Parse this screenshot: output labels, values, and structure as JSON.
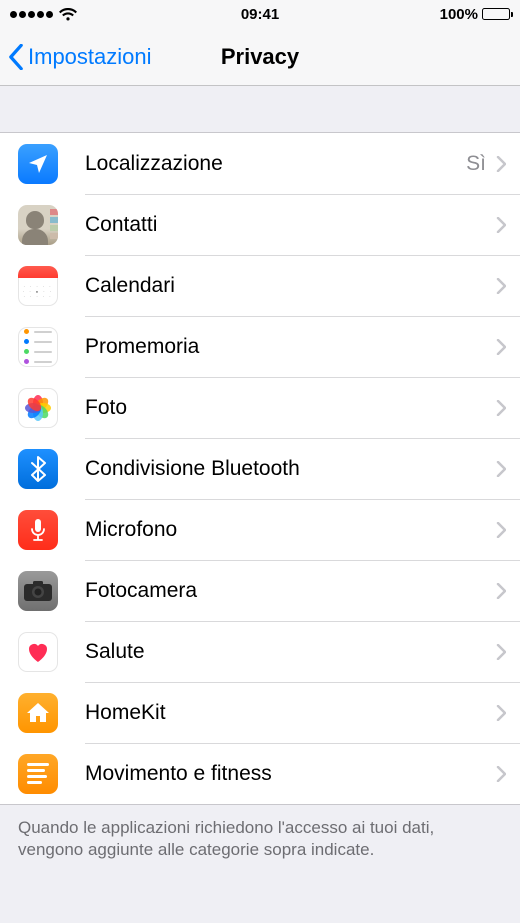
{
  "status": {
    "time": "09:41",
    "battery_pct": "100%"
  },
  "nav": {
    "back_label": "Impostazioni",
    "title": "Privacy"
  },
  "rows": [
    {
      "id": "location",
      "label": "Localizzazione",
      "value": "Sì",
      "icon": "location-arrow-icon"
    },
    {
      "id": "contacts",
      "label": "Contatti",
      "value": "",
      "icon": "contacts-icon"
    },
    {
      "id": "calendars",
      "label": "Calendari",
      "value": "",
      "icon": "calendar-icon"
    },
    {
      "id": "reminders",
      "label": "Promemoria",
      "value": "",
      "icon": "reminders-icon"
    },
    {
      "id": "photos",
      "label": "Foto",
      "value": "",
      "icon": "photos-icon"
    },
    {
      "id": "bluetooth",
      "label": "Condivisione Bluetooth",
      "value": "",
      "icon": "bluetooth-icon"
    },
    {
      "id": "microphone",
      "label": "Microfono",
      "value": "",
      "icon": "microphone-icon"
    },
    {
      "id": "camera",
      "label": "Fotocamera",
      "value": "",
      "icon": "camera-icon"
    },
    {
      "id": "health",
      "label": "Salute",
      "value": "",
      "icon": "heart-icon"
    },
    {
      "id": "homekit",
      "label": "HomeKit",
      "value": "",
      "icon": "home-icon"
    },
    {
      "id": "motion",
      "label": "Movimento e fitness",
      "value": "",
      "icon": "motion-icon"
    }
  ],
  "footer": "Quando le applicazioni richiedono l'accesso ai tuoi dati, vengono aggiunte alle categorie sopra indicate."
}
